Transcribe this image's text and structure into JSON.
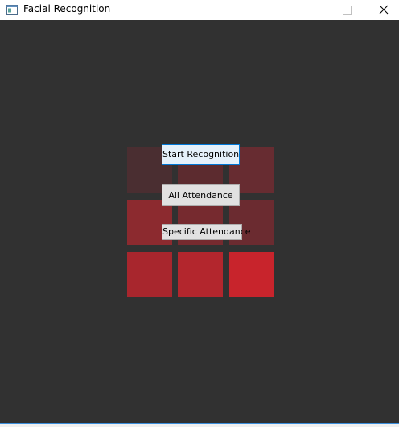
{
  "window": {
    "title": "Facial Recognition",
    "icon": "window-app-icon",
    "controls": [
      "minimize-icon",
      "maximize-icon",
      "close-icon"
    ]
  },
  "buttons": {
    "start_recognition": "Start Recognition",
    "all_attendance": "All Attendance",
    "specific_attendance": "Specific Attendance"
  },
  "colors": {
    "background": "#313131",
    "tile_dark": "#4a2e31",
    "tile_bright": "#c8242c",
    "focus_border": "#0078d7"
  }
}
